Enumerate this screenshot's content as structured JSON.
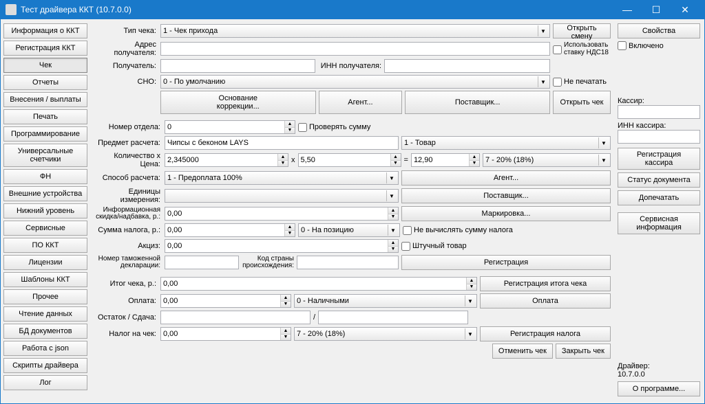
{
  "window": {
    "title": "Тест драйвера ККТ (10.7.0.0)"
  },
  "sidebar": {
    "items": [
      "Информация о ККТ",
      "Регистрация ККТ",
      "Чек",
      "Отчеты",
      "Внесения / выплаты",
      "Печать",
      "Программирование",
      "Универсальные счетчики",
      "ФН",
      "Внешние устройства",
      "Нижний уровень",
      "Сервисные",
      "ПО ККТ",
      "Лицензии",
      "Шаблоны ККТ",
      "Прочее",
      "Чтение данных",
      "БД документов",
      "Работа с json",
      "Скрипты драйвера",
      "Лог"
    ],
    "active": 2
  },
  "main": {
    "checkType": {
      "label": "Тип чека:",
      "value": "1 - Чек прихода"
    },
    "openShift": "Открыть смену",
    "recipientAddr": {
      "label": "Адрес получателя:"
    },
    "vat18": {
      "line1": "Использовать",
      "line2": "ставку НДС18"
    },
    "recipient": {
      "label": "Получатель:"
    },
    "innRecipient": {
      "label": "ИНН получателя:"
    },
    "sno": {
      "label": "СНО:",
      "value": "0 - По умолчанию"
    },
    "dontPrint": "Не печатать",
    "correctionBase": {
      "line1": "Основание",
      "line2": "коррекции..."
    },
    "agentBtn": "Агент...",
    "supplierBtn": "Поставщик...",
    "openCheck": "Открыть чек",
    "deptNum": {
      "label": "Номер отдела:",
      "value": "0"
    },
    "checkSum": "Проверять сумму",
    "subject": {
      "label": "Предмет расчета:",
      "value": "Чипсы с беконом LAYS",
      "type": "1 - Товар"
    },
    "qtyPrice": {
      "label": "Количество x Цена:",
      "qty": "2,345000",
      "x": "x",
      "price": "5,50",
      "eq": "=",
      "total": "12,90",
      "vat": "7 - 20% (18%)"
    },
    "paymentMethod": {
      "label": "Способ расчета:",
      "value": "1 - Предоплата 100%"
    },
    "agentBtn2": "Агент...",
    "units": {
      "label": "Единицы измерения:"
    },
    "supplierBtn2": "Поставщик...",
    "infoDiscount": {
      "line1": "Информационная",
      "line2": "скидка/надбавка, р.:",
      "value": "0,00"
    },
    "marking": "Маркировка...",
    "taxSum": {
      "label": "Сумма налога, р.:",
      "value": "0,00",
      "mode": "0 - На позицию",
      "noCalc": "Не вычислять сумму налога"
    },
    "excise": {
      "label": "Акциз:",
      "value": "0,00",
      "piece": "Штучный товар"
    },
    "customs": {
      "line1": "Номер таможенной",
      "line2": "декларации:",
      "countryLabel1": "Код страны",
      "countryLabel2": "происхождения:"
    },
    "registration": "Регистрация",
    "checkTotal": {
      "label": "Итог чека, р.:",
      "value": "0,00"
    },
    "regTotal": "Регистрация итога чека",
    "payment": {
      "label": "Оплата:",
      "value": "0,00",
      "type": "0 - Наличными",
      "btn": "Оплата"
    },
    "change": {
      "label": "Остаток / Сдача:"
    },
    "checkTax": {
      "label": "Налог на чек:",
      "value": "0,00",
      "type": "7 - 20% (18%)",
      "btn": "Регистрация налога"
    },
    "cancelCheck": "Отменить чек",
    "closeCheck": "Закрыть чек"
  },
  "right": {
    "properties": "Свойства",
    "enabled": "Включено",
    "cashier": "Кассир:",
    "cashierInn": "ИНН кассира:",
    "regCashier": {
      "line1": "Регистрация",
      "line2": "кассира"
    },
    "docStatus": "Статус документа",
    "finishPrint": "Допечатать",
    "serviceInfo": {
      "line1": "Сервисная",
      "line2": "информация"
    },
    "driver": "Драйвер:",
    "driverVer": "10.7.0.0",
    "about": "О программе..."
  }
}
